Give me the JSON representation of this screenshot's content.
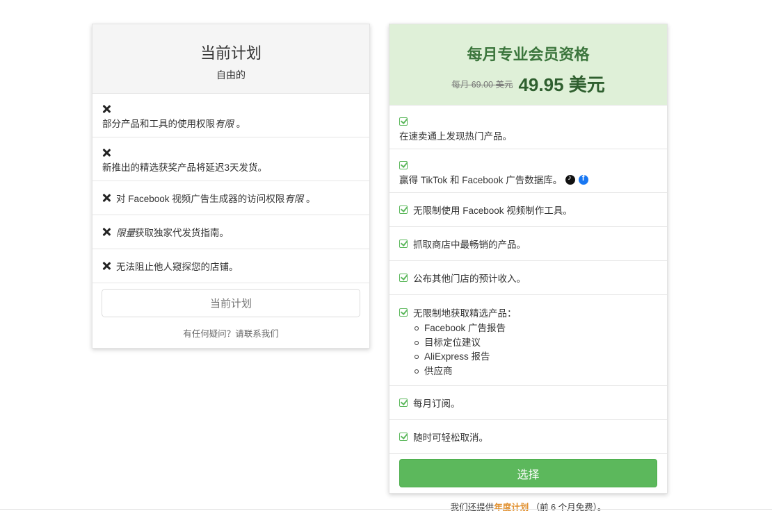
{
  "free_plan": {
    "title": "当前计划",
    "subtitle": "自由的",
    "features": [
      {
        "text_before": "部分产品和工具的使用权限",
        "emphasis": "有限",
        "text_after": " 。"
      },
      {
        "text_before": "新推出的精选获奖产品将延迟3天发货。",
        "emphasis": "",
        "text_after": ""
      },
      {
        "text_before": "对 Facebook 视频广告生成器的访问权限",
        "emphasis": "有限",
        "text_after": " 。"
      },
      {
        "text_before": "",
        "emphasis": "限量",
        "text_after": "获取独家代发货指南。"
      },
      {
        "text_before": "无法阻止他人窥探您的店铺。",
        "emphasis": "",
        "text_after": ""
      }
    ],
    "button_label": "当前计划",
    "contact_text": "有任何疑问？请联系我们"
  },
  "pro_plan": {
    "title": "每月专业会员资格",
    "price_old": "每月 69.00 美元",
    "price_new": "49.95 美元",
    "features": [
      "在速卖通上发现热门产品。",
      "赢得 TikTok 和 Facebook 广告数据库。",
      "无限制使用 Facebook 视频制作工具。",
      "抓取商店中最畅销的产品。",
      "公布其他门店的预计收入。",
      "无限制地获取精选产品：",
      "每月订阅。",
      "随时可轻松取消。"
    ],
    "sub_features": [
      "Facebook 广告报告",
      "目标定位建议",
      "AliExpress 报告",
      "供应商"
    ],
    "icons": {
      "feature": "check-square-icon",
      "social": [
        "tiktok-icon",
        "facebook-icon"
      ]
    },
    "button_label": "选择"
  },
  "annual_note": {
    "before": "我们还提供",
    "link": "年度计划",
    "after": " （前 6 个月免费）。"
  },
  "colors": {
    "pro_header_bg": "#dff0d8",
    "pro_title": "#3c763d",
    "check": "#5cb85c",
    "choose_button": "#5cb85c",
    "annual_link": "#e08e2b"
  }
}
